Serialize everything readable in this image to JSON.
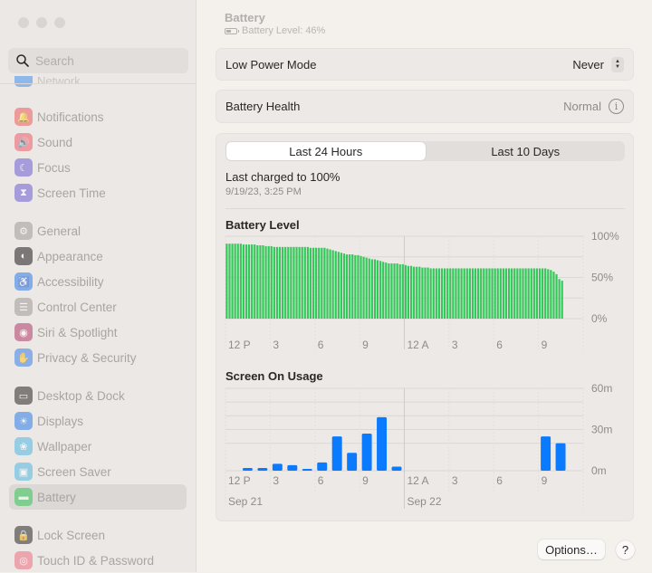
{
  "window": {
    "traffic_lights": [
      "close",
      "minimize",
      "zoom"
    ]
  },
  "sidebar": {
    "search": {
      "placeholder": "Search",
      "value": ""
    },
    "partial_item": {
      "label": "Network",
      "icon": "network-icon",
      "color": "#8fb8ea"
    },
    "items": [
      {
        "label": "Notifications",
        "icon": "bell-icon",
        "color": "#ee5d5d",
        "glyph": "🔔"
      },
      {
        "label": "Sound",
        "icon": "speaker-icon",
        "color": "#ee5d6a",
        "glyph": "🔊"
      },
      {
        "label": "Focus",
        "icon": "moon-icon",
        "color": "#6e5fd6",
        "glyph": "☾"
      },
      {
        "label": "Screen Time",
        "icon": "hourglass-icon",
        "color": "#6e5fd6",
        "glyph": "⧗"
      },
      {
        "label": "General",
        "icon": "gear-icon",
        "color": "#9e9a98",
        "glyph": "⚙"
      },
      {
        "label": "Appearance",
        "icon": "appearance-icon",
        "color": "#1e1c1c",
        "glyph": "◐"
      },
      {
        "label": "Accessibility",
        "icon": "accessibility-icon",
        "color": "#2f7ee8",
        "glyph": "♿"
      },
      {
        "label": "Control Center",
        "icon": "control-center-icon",
        "color": "#9e9a98",
        "glyph": "☰"
      },
      {
        "label": "Siri & Spotlight",
        "icon": "siri-icon",
        "color": "#b03a6a",
        "glyph": "◉"
      },
      {
        "label": "Privacy & Security",
        "icon": "hand-icon",
        "color": "#3b82e8",
        "glyph": "✋"
      },
      {
        "label": "Desktop & Dock",
        "icon": "dock-icon",
        "color": "#2a2726",
        "glyph": "▭"
      },
      {
        "label": "Displays",
        "icon": "sun-icon",
        "color": "#2f7ee8",
        "glyph": "☀"
      },
      {
        "label": "Wallpaper",
        "icon": "flower-icon",
        "color": "#52b8e0",
        "glyph": "❀"
      },
      {
        "label": "Screen Saver",
        "icon": "screen-saver-icon",
        "color": "#52b8e0",
        "glyph": "▣"
      },
      {
        "label": "Battery",
        "icon": "battery-icon",
        "color": "#34c759",
        "glyph": "▬",
        "active": true
      },
      {
        "label": "Lock Screen",
        "icon": "lock-icon",
        "color": "#2a2726",
        "glyph": "🔒"
      },
      {
        "label": "Touch ID & Password",
        "icon": "fingerprint-icon",
        "color": "#ee7080",
        "glyph": "◎"
      }
    ]
  },
  "header": {
    "title": "Battery",
    "subtitle": "Battery Level: 46%"
  },
  "low_power": {
    "label": "Low Power Mode",
    "value": "Never"
  },
  "health": {
    "label": "Battery Health",
    "value": "Normal"
  },
  "usage": {
    "tabs": [
      {
        "label": "Last 24 Hours",
        "selected": true
      },
      {
        "label": "Last 10 Days",
        "selected": false
      }
    ],
    "last_charged_label": "Last charged to 100%",
    "last_charged_time": "9/19/23, 3:25 PM"
  },
  "chart_data": [
    {
      "type": "bar",
      "title": "Battery Level",
      "ylabel": "",
      "xlabel": "",
      "ylim": [
        0,
        100
      ],
      "yticks": [
        "100%",
        "50%",
        "0%"
      ],
      "xticks": [
        "12 P",
        "3",
        "6",
        "9",
        "12 A",
        "3",
        "6",
        "9"
      ],
      "color": "#34c759",
      "values": [
        91,
        91,
        91,
        91,
        91,
        91,
        90,
        90,
        90,
        90,
        90,
        89,
        89,
        89,
        88,
        88,
        88,
        87,
        87,
        87,
        87,
        87,
        87,
        87,
        87,
        87,
        87,
        87,
        87,
        87,
        86,
        86,
        86,
        86,
        86,
        86,
        85,
        84,
        83,
        82,
        81,
        80,
        79,
        78,
        78,
        78,
        77,
        77,
        76,
        75,
        74,
        73,
        72,
        72,
        71,
        70,
        69,
        68,
        67,
        67,
        67,
        67,
        66,
        66,
        65,
        64,
        64,
        63,
        63,
        63,
        62,
        62,
        62,
        61,
        61,
        61,
        61,
        61,
        61,
        61,
        61,
        61,
        61,
        61,
        61,
        61,
        61,
        61,
        61,
        61,
        61,
        61,
        61,
        61,
        61,
        61,
        61,
        61,
        61,
        61,
        61,
        61,
        61,
        61,
        61,
        61,
        61,
        61,
        61,
        61,
        61,
        61,
        61,
        61,
        61,
        60,
        59,
        57,
        54,
        48,
        46
      ]
    },
    {
      "type": "bar",
      "title": "Screen On Usage",
      "ylabel": "",
      "xlabel": "",
      "ylim": [
        0,
        60
      ],
      "yticks": [
        "60m",
        "30m",
        "0m"
      ],
      "xticks": [
        "12 P",
        "3",
        "6",
        "9",
        "12 A",
        "3",
        "6",
        "9"
      ],
      "date_labels": [
        "Sep 21",
        "Sep 22"
      ],
      "color": "#0a7aff",
      "categories": [
        "12P",
        "1P",
        "2P",
        "3P",
        "4P",
        "5P",
        "6P",
        "7P",
        "8P",
        "9P",
        "10P",
        "11P",
        "12A",
        "1A",
        "2A",
        "3A",
        "4A",
        "5A",
        "6A",
        "7A",
        "8A",
        "9A",
        "10A",
        "11A"
      ],
      "values": [
        0,
        2,
        2,
        5,
        4,
        1,
        6,
        25,
        13,
        27,
        39,
        3,
        0,
        0,
        0,
        0,
        0,
        0,
        0,
        0,
        0,
        25,
        20,
        0
      ]
    }
  ],
  "footer": {
    "options_label": "Options…",
    "help_label": "?"
  }
}
